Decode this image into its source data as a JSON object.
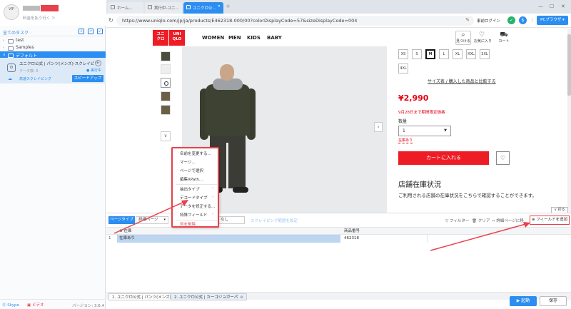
{
  "sidebar": {
    "user": {
      "avatar_text": "VIP",
      "pay_text": "料金を払う行く ＞"
    },
    "header_title": "全てのタスク",
    "tree": [
      "test",
      "Samples",
      "デフォルト"
    ],
    "task": {
      "name": "ユニクロ公式 | パンツ(メンズ)-スクレイピン",
      "sub": "データ数: 0",
      "run_status": "● 実行中",
      "cloud_label": "高速スクレイピング",
      "speed_button": "スピードアップ"
    },
    "footer": {
      "skype": "Skype",
      "video": "ビデオ",
      "version": "バージョン: 3.6.4"
    }
  },
  "browser": {
    "tabs": [
      {
        "label": "ホーム..."
      },
      {
        "label": "実行中-ユニ..."
      },
      {
        "label": "ユニクロ公..."
      }
    ],
    "new_tab": "+",
    "url": "https://www.uniqlo.com/jp/ja/products/E462318-000/00?colorDisplayCode=57&sizeDisplayCode=004",
    "login_link": "事前ログイン",
    "pc_browser": "PCブラウザ ▾"
  },
  "site": {
    "logo": [
      "ユニ\nクロ",
      "UNI\nQLO"
    ],
    "nav": [
      "WOMEN",
      "MEN",
      "KIDS",
      "BABY"
    ],
    "header_icons": [
      {
        "glyph": "⌕",
        "label": "見つける"
      },
      {
        "glyph": "♡",
        "label": "お気に入り"
      },
      {
        "glyph": "⛟",
        "label": "カート"
      }
    ],
    "sizes": [
      "XS",
      "S",
      "M",
      "L",
      "XL",
      "XXL",
      "3XL",
      "4XL"
    ],
    "size_selected": "M",
    "size_link": "サイズ表 / 購入した商品と比較する",
    "price": "¥2,990",
    "price_note": "9月28日まで期間限定価格",
    "qty_label": "数量",
    "qty_value": "1",
    "stock_note": "在庫あり",
    "cart_button": "カートに入れる",
    "store_heading": "店舗在庫状況",
    "store_text": "ご利用される店舗の在庫状況をこちらで確認することができます。",
    "collapse_label": "∨ 折る"
  },
  "context_menu": {
    "items": [
      "名前を変更する...",
      "マージ...",
      "ページで選択",
      "編集XPath...",
      "抽出タイプ",
      "デコードタイプ",
      "データを修正する...",
      "特殊フィールド",
      "列を削除"
    ]
  },
  "bottom": {
    "page_type_label": "ページタイプ",
    "page_type_value": "詳細ページ",
    "second_select": "なし",
    "scroll_link": "スクレイピング範囲を設定",
    "filter": "フィルター",
    "clear": "クリア",
    "detail_link": "詳細ページに移",
    "add_field": "⊕ フィールドを追加",
    "columns": [
      "在庫",
      "商品番号"
    ],
    "rows": [
      {
        "num": "1",
        "stock": "在庫あり",
        "code": "462318"
      }
    ],
    "tabs": [
      {
        "label": "1. ユニクロ公式 | パンツ(メンズ)"
      },
      {
        "label": "2. ユニクロ公式 | カーゴジョガーパ"
      }
    ],
    "run_button": "▶ 起動",
    "save_button": "保存"
  }
}
